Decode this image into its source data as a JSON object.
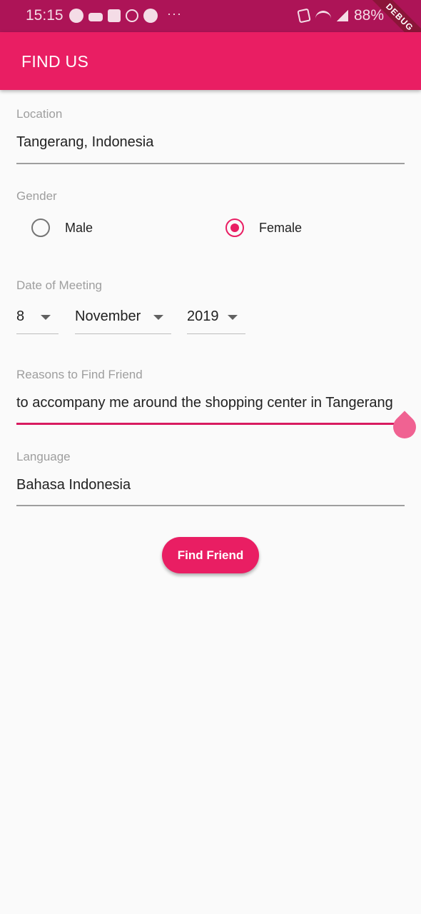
{
  "status_bar": {
    "time": "15:15",
    "notification_icons": [
      "line-icon",
      "car-icon",
      "app-icon",
      "coin-icon",
      "message-icon"
    ],
    "more": "···",
    "battery": "88%",
    "color": "#ad1457"
  },
  "debug_banner": {
    "label": "DEBUG"
  },
  "app_bar": {
    "title": "FIND US",
    "color": "#e91e63"
  },
  "location": {
    "label": "Location",
    "value": "Tangerang, Indonesia"
  },
  "gender": {
    "label": "Gender",
    "options": [
      {
        "label": "Male",
        "selected": false
      },
      {
        "label": "Female",
        "selected": true
      }
    ]
  },
  "date_of_meeting": {
    "label": "Date of Meeting",
    "day": "8",
    "month": "November",
    "year": "2019"
  },
  "reasons": {
    "label": "Reasons to Find Friend",
    "value": "to accompany me around the shopping center in Tangerang"
  },
  "language": {
    "label": "Language",
    "value": "Bahasa Indonesia"
  },
  "find_button": {
    "label": "Find Friend"
  },
  "colors": {
    "accent": "#e91e63",
    "focus": "#d81b60",
    "handle": "#f06292"
  }
}
